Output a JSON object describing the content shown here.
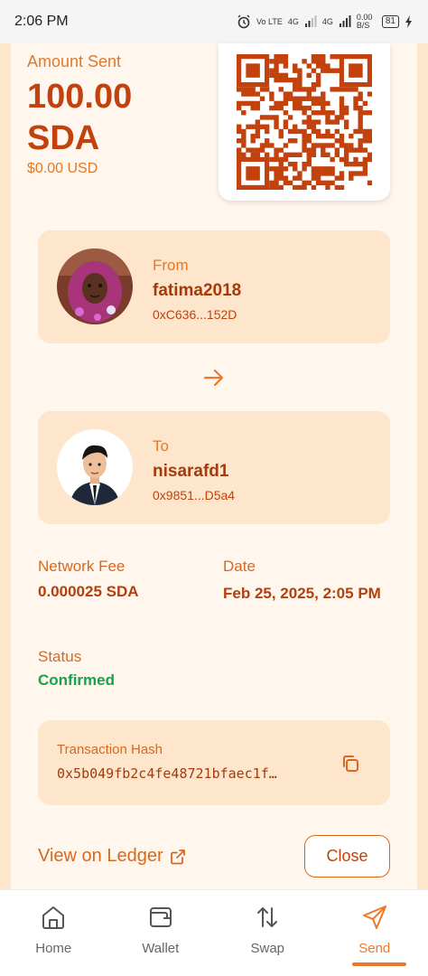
{
  "status_bar": {
    "time": "2:06 PM",
    "network_vo": "Vo LTE",
    "network_4g_1": "4G",
    "network_4g_2": "4G",
    "speed": "0.00 B/S",
    "battery": "81"
  },
  "transaction": {
    "amount_label": "Amount Sent",
    "amount_value": "100.00 SDA",
    "amount_usd": "$0.00 USD",
    "from": {
      "label": "From",
      "name": "fatima2018",
      "address": "0xC636...152D"
    },
    "to": {
      "label": "To",
      "name": "nisarafd1",
      "address": "0x9851...D5a4"
    },
    "network_fee_label": "Network Fee",
    "network_fee_value": "0.000025 SDA",
    "date_label": "Date",
    "date_value": "Feb 25, 2025, 2:05 PM",
    "status_label": "Status",
    "status_value": "Confirmed",
    "status_color": "#16a34a",
    "hash_label": "Transaction Hash",
    "hash_value": "0x5b049fb2c4fe48721bfaec1f…"
  },
  "actions": {
    "ledger_link": "View on Ledger",
    "close_button": "Close"
  },
  "nav": {
    "items": [
      {
        "label": "Home",
        "icon": "home-icon"
      },
      {
        "label": "Wallet",
        "icon": "wallet-icon"
      },
      {
        "label": "Swap",
        "icon": "swap-icon"
      },
      {
        "label": "Send",
        "icon": "send-icon"
      }
    ],
    "active": "Send"
  },
  "colors": {
    "accent": "#ea7a2a",
    "primary_text": "#c2410c",
    "card_bg": "#fde6cc",
    "success": "#16a34a"
  }
}
